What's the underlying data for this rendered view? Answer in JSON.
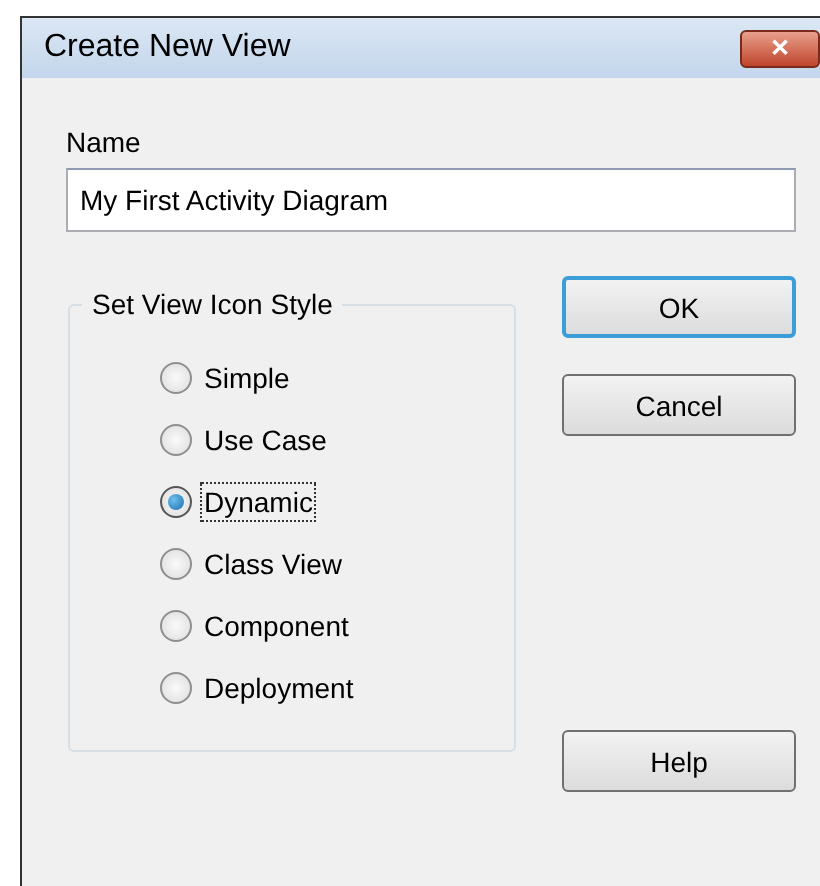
{
  "window": {
    "title": "Create New View",
    "close": "✕"
  },
  "name_field": {
    "label": "Name",
    "value": "My First Activity Diagram"
  },
  "icon_style": {
    "title": "Set View Icon Style",
    "options": [
      {
        "label": "Simple",
        "selected": false
      },
      {
        "label": "Use Case",
        "selected": false
      },
      {
        "label": "Dynamic",
        "selected": true
      },
      {
        "label": "Class View",
        "selected": false
      },
      {
        "label": "Component",
        "selected": false
      },
      {
        "label": "Deployment",
        "selected": false
      }
    ]
  },
  "buttons": [
    {
      "label": "OK",
      "default": true
    },
    {
      "label": "Cancel",
      "default": false
    }
  ],
  "help_button": {
    "label": "Help"
  }
}
